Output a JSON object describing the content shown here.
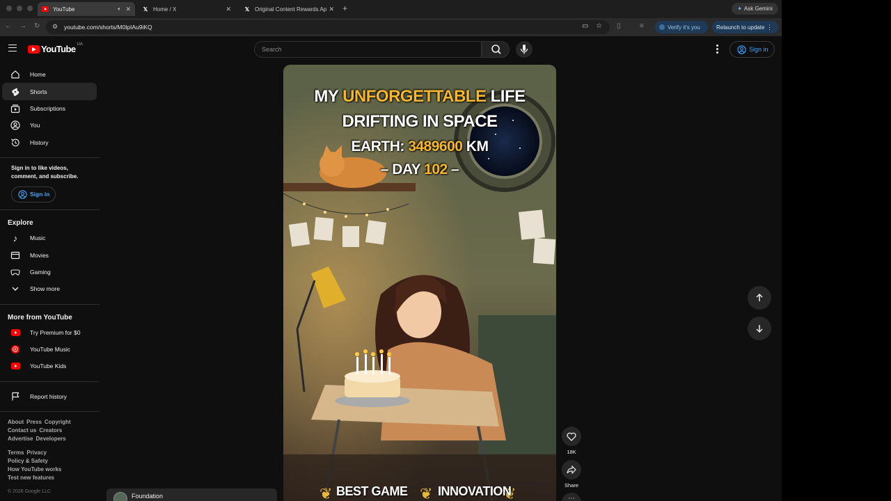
{
  "browser": {
    "tabs": [
      {
        "label": "YouTube"
      },
      {
        "label": "Home / X"
      },
      {
        "label": "Original Content Rewards Ap"
      }
    ],
    "url": "youtube.com/shorts/M0lpIAu9iKQ",
    "ask_gemini": "Ask Gemini",
    "verify": "Verify it's you",
    "relaunch": "Relaunch to update"
  },
  "masthead": {
    "logo": "YouTube",
    "country": "UA",
    "search_placeholder": "Search",
    "sign_in": "Sign in"
  },
  "sidebar": {
    "main": [
      {
        "label": "Home",
        "icon": "home-icon"
      },
      {
        "label": "Shorts",
        "icon": "shorts-icon"
      },
      {
        "label": "Subscriptions",
        "icon": "subscriptions-icon"
      },
      {
        "label": "You",
        "icon": "you-icon"
      },
      {
        "label": "History",
        "icon": "history-icon"
      }
    ],
    "signin_prompt": "Sign in to like videos, comment, and subscribe.",
    "sign_in": "Sign in",
    "explore_title": "Explore",
    "explore": [
      {
        "label": "Music"
      },
      {
        "label": "Movies"
      },
      {
        "label": "Gaming"
      },
      {
        "label": "Show more"
      }
    ],
    "more_title": "More from YouTube",
    "more": [
      {
        "label": "Try Premium for $0"
      },
      {
        "label": "YouTube Music"
      },
      {
        "label": "YouTube Kids"
      }
    ],
    "report": "Report history",
    "footer1": [
      "About",
      "Press",
      "Copyright"
    ],
    "footer2": [
      "Contact us",
      "Creators"
    ],
    "footer3": [
      "Advertise",
      "Developers"
    ],
    "footer4": [
      "Terms",
      "Privacy"
    ],
    "footer5": "Policy & Safety",
    "footer6": "How YouTube works",
    "footer7": "Test new features",
    "copyright": "© 2026 Google LLC"
  },
  "short": {
    "line1_a": "MY ",
    "line1_b": "UNFORGETTABLE",
    "line1_c": " LIFE",
    "line2": "DRIFTING IN SPACE",
    "line3_a": "EARTH: ",
    "line3_b": "3489600",
    "line3_c": " KM",
    "line4_a": "– DAY ",
    "line4_b": "102",
    "line4_c": " –",
    "badge1": "BEST GAME",
    "badge2": "INNOVATION",
    "channel": "Foundation",
    "likes": "18K",
    "share": "Share"
  }
}
